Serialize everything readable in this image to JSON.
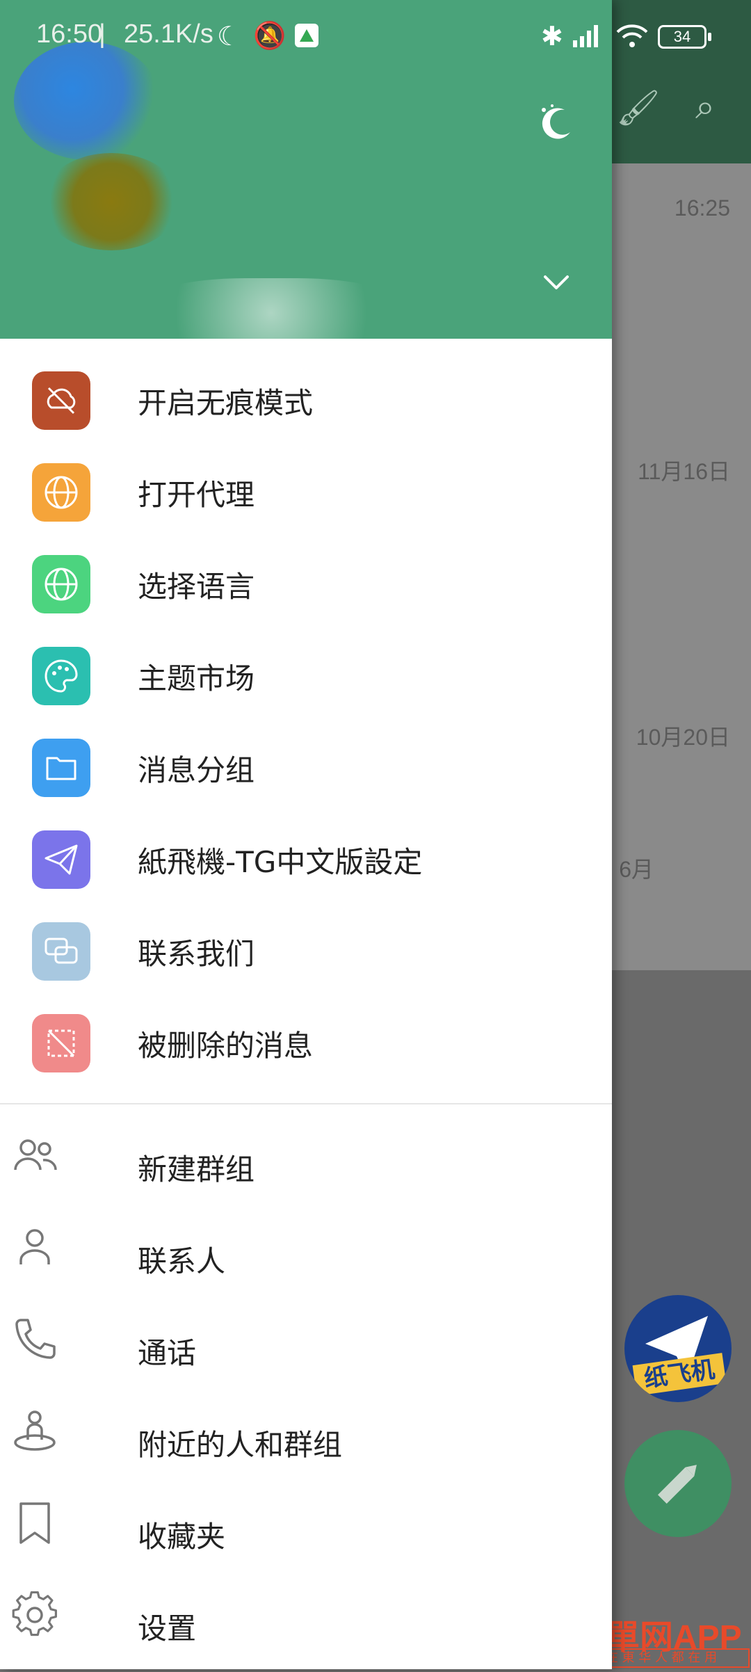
{
  "status_bar": {
    "time": "16:50",
    "separator": "|",
    "net_speed": "25.1K/s",
    "battery": "34",
    "icons": [
      "moon-icon",
      "mute-icon",
      "drive-icon",
      "bluetooth-icon",
      "signal-hd-icon",
      "wifi-icon",
      "battery-icon"
    ]
  },
  "background": {
    "rows": [
      "16:25",
      "11月16日",
      "10月20日",
      "6月"
    ]
  },
  "header": {
    "icons": [
      "night-mode-moon-icon",
      "expand-accounts-chevron-icon"
    ],
    "accent": "#4aa37a"
  },
  "menu": {
    "colored_items": [
      {
        "label": "开启无痕模式",
        "icon": "incognito-cloud-icon",
        "color": "#b84d2b"
      },
      {
        "label": "打开代理",
        "icon": "proxy-globe-icon",
        "color": "#f5a43a"
      },
      {
        "label": "选择语言",
        "icon": "language-globe-icon",
        "color": "#4cd47f"
      },
      {
        "label": "主题市场",
        "icon": "palette-icon",
        "color": "#2bbfb0"
      },
      {
        "label": "消息分组",
        "icon": "folder-icon",
        "color": "#3e9ff0"
      },
      {
        "label": "紙飛機-TG中文版設定",
        "icon": "paper-plane-icon",
        "color": "#7b74ea"
      },
      {
        "label": "联系我们",
        "icon": "chat-bubbles-icon",
        "color": "#a8c8e0"
      },
      {
        "label": "被删除的消息",
        "icon": "deleted-message-icon",
        "color": "#f08a8a"
      }
    ],
    "plain_items": [
      {
        "label": "新建群组",
        "icon": "group-icon"
      },
      {
        "label": "联系人",
        "icon": "person-icon"
      },
      {
        "label": "通话",
        "icon": "phone-icon"
      },
      {
        "label": "附近的人和群组",
        "icon": "nearby-icon"
      },
      {
        "label": "收藏夹",
        "icon": "bookmark-icon"
      },
      {
        "label": "设置",
        "icon": "gear-icon"
      }
    ]
  },
  "fab": {
    "brand_text": "纸飞机"
  },
  "watermark": {
    "title": "東單网APP",
    "subtitle": "在 東 华 人 都 在 用"
  }
}
